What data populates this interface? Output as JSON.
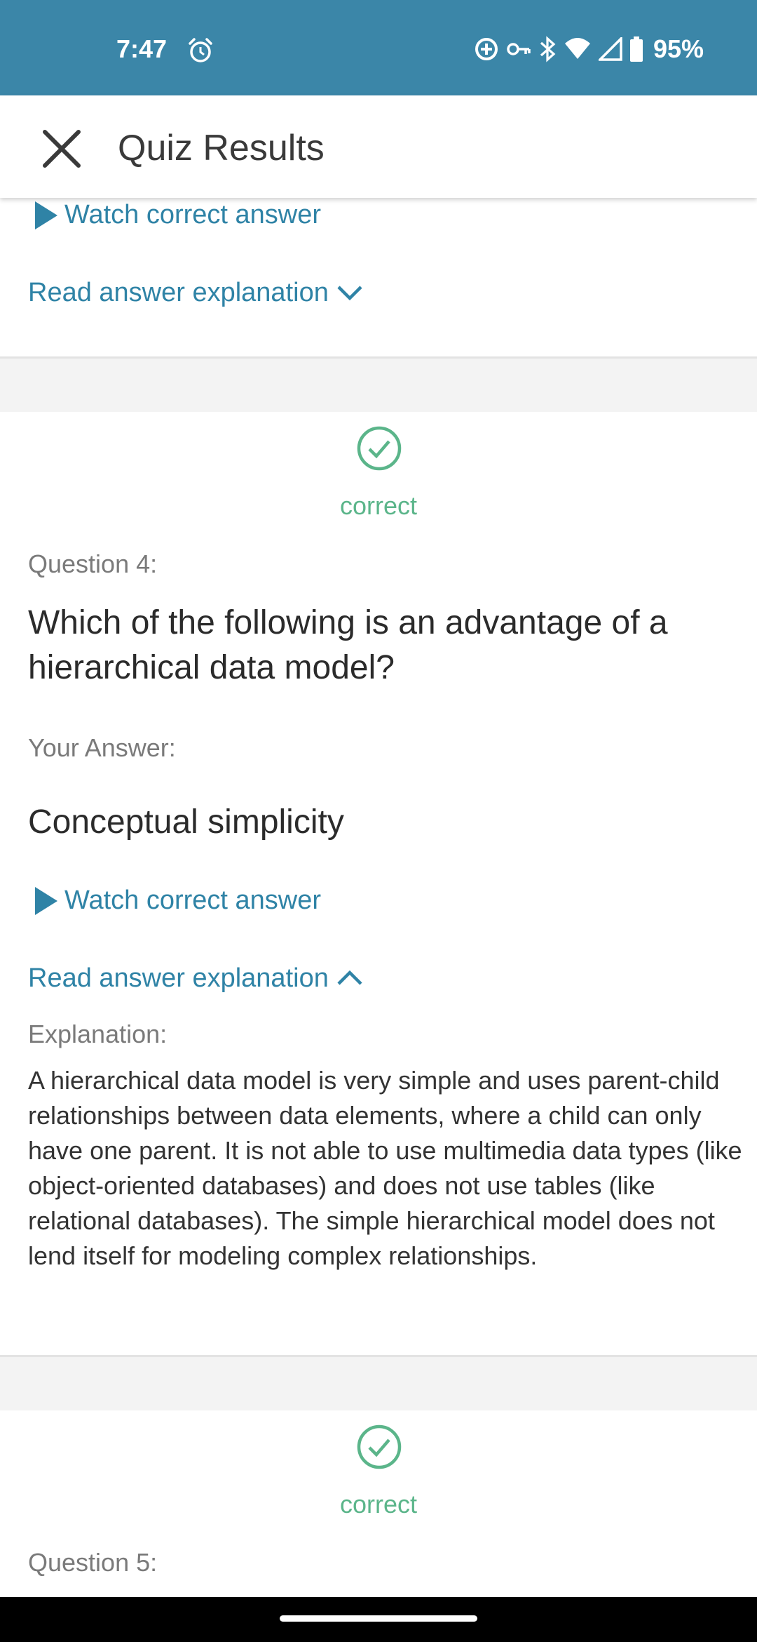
{
  "status_bar": {
    "time": "7:47",
    "battery": "95%",
    "icons": [
      "alarm-icon",
      "data-saver-icon",
      "vpn-key-icon",
      "bluetooth-icon",
      "wifi-icon",
      "cell-signal-icon",
      "battery-icon"
    ]
  },
  "app_bar": {
    "title": "Quiz Results",
    "close_icon": "close-icon"
  },
  "question_3_tail": {
    "watch_label": "Watch correct answer",
    "read_label": "Read answer explanation"
  },
  "question_4": {
    "status": "correct",
    "label": "Question 4:",
    "text": "Which of the following is an advantage of a hierarchical data model?",
    "your_answer_label": "Your Answer:",
    "your_answer": "Conceptual simplicity",
    "watch_label": "Watch correct answer",
    "read_label": "Read answer explanation",
    "explanation_label": "Explanation:",
    "explanation": "A hierarchical data model is very simple and uses parent-child relationships between data elements, where a child can only have one parent. It is not able to use multimedia data types (like object-oriented databases) and does not use tables (like relational databases). The simple hierarchical model does not lend itself for modeling complex relationships."
  },
  "question_5": {
    "status": "correct",
    "label": "Question 5:"
  },
  "colors": {
    "status_bar": "#3b86a8",
    "link": "#2f83a6",
    "correct": "#5bb58a",
    "separator": "#f3f3f3"
  }
}
